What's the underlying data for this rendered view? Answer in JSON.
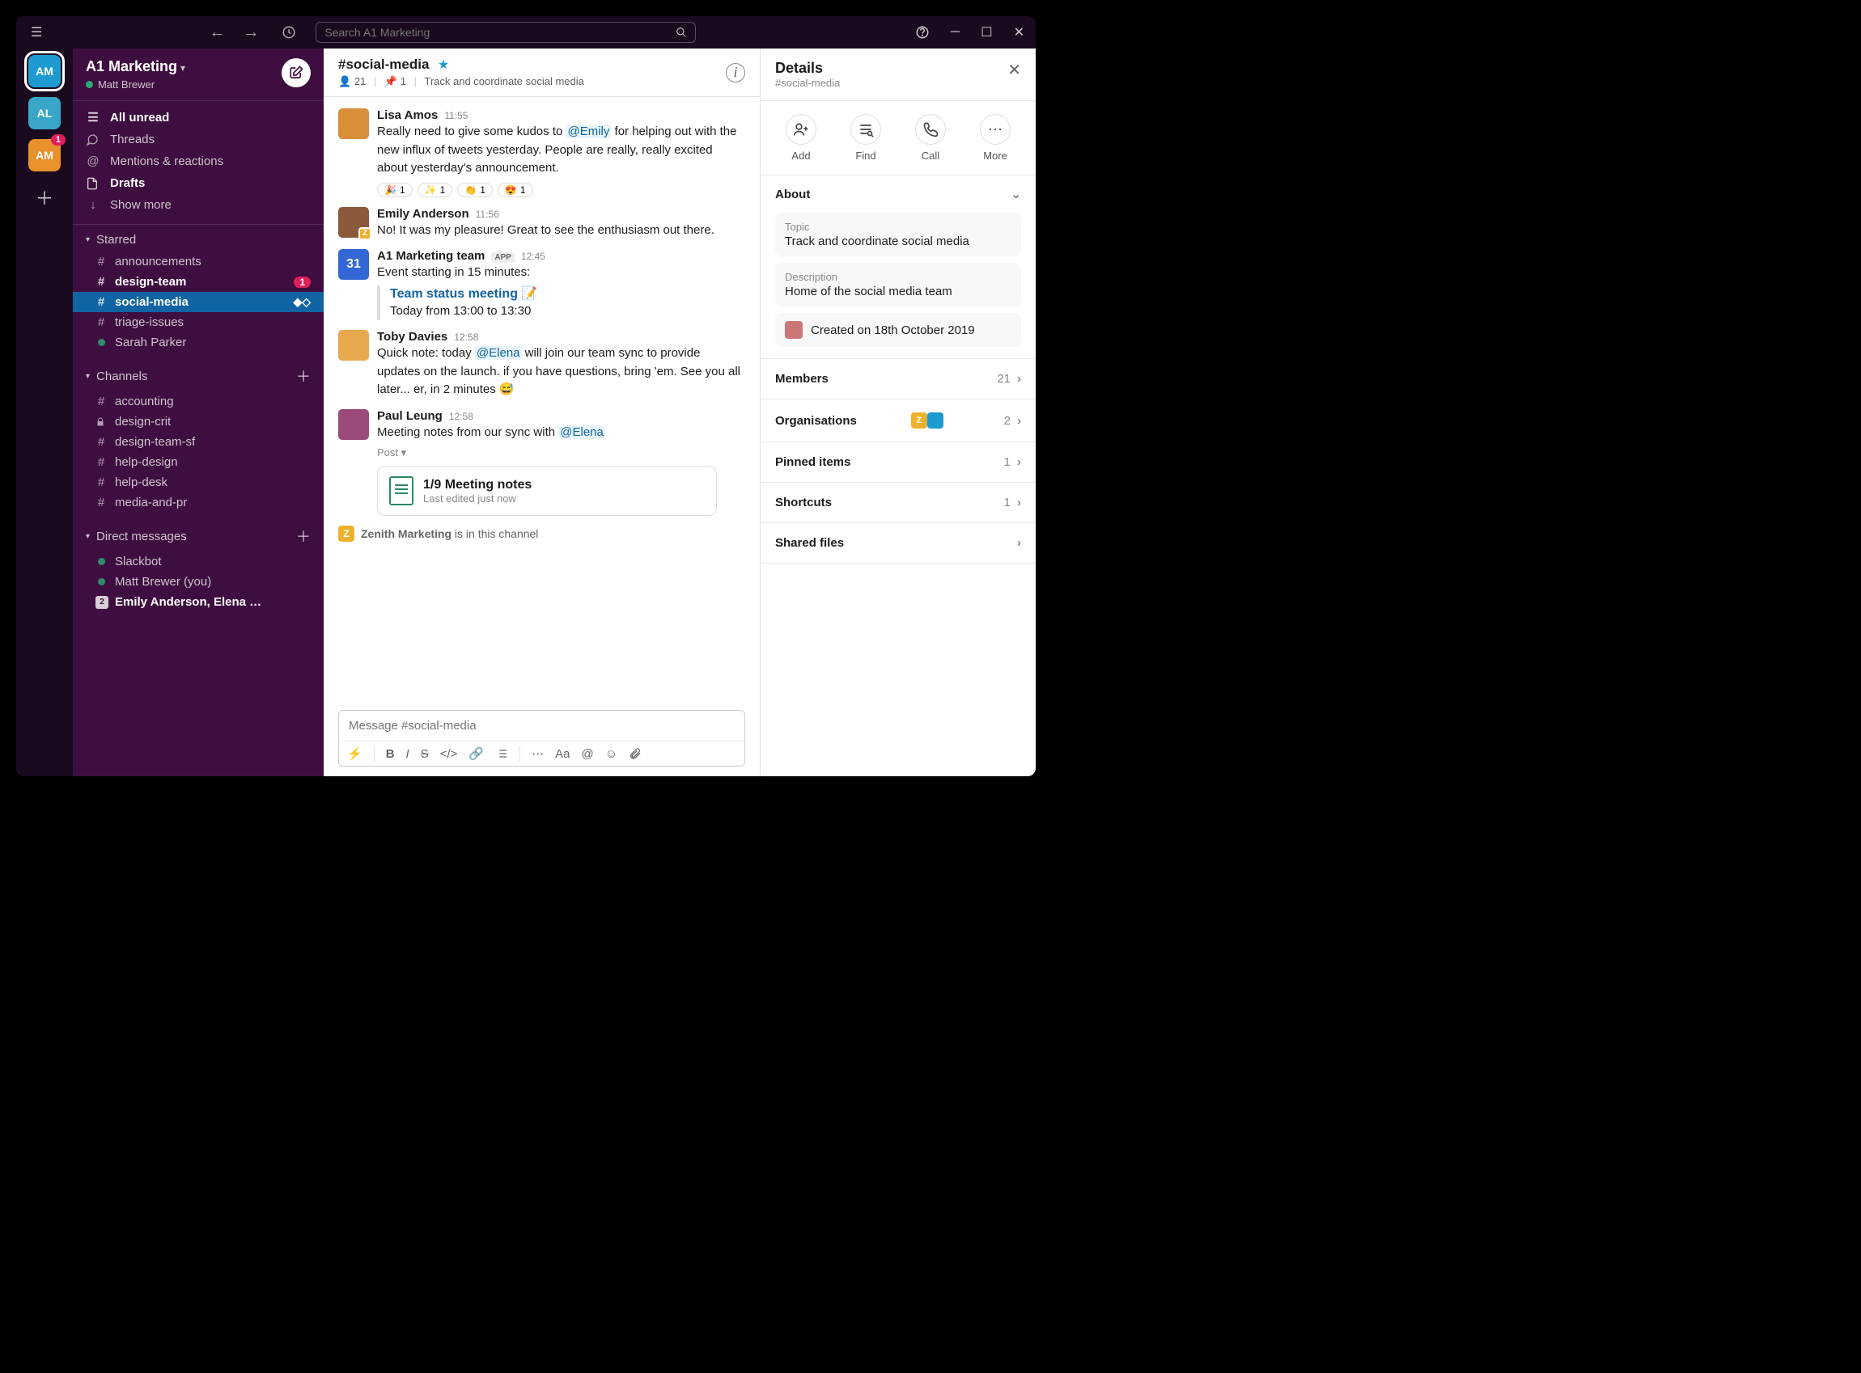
{
  "titlebar": {
    "search_placeholder": "Search A1 Marketing"
  },
  "rail": {
    "workspaces": [
      {
        "initials": "AM",
        "color": "#1d9bd1",
        "active": true,
        "badge": null
      },
      {
        "initials": "AL",
        "color": "#38a5c9",
        "active": false,
        "badge": null
      },
      {
        "initials": "AM",
        "color": "#e8912d",
        "active": false,
        "badge": "1"
      }
    ]
  },
  "sidebar": {
    "workspace_name": "A1 Marketing",
    "user_name": "Matt Brewer",
    "nav": {
      "all_unread": "All unread",
      "threads": "Threads",
      "mentions": "Mentions & reactions",
      "drafts": "Drafts",
      "show_more": "Show more"
    },
    "starred_label": "Starred",
    "starred": [
      {
        "name": "announcements",
        "prefix": "#",
        "bold": false
      },
      {
        "name": "design-team",
        "prefix": "#",
        "bold": true,
        "badge": "1"
      },
      {
        "name": "social-media",
        "prefix": "#",
        "bold": true,
        "active": true
      },
      {
        "name": "triage-issues",
        "prefix": "#",
        "bold": false
      },
      {
        "name": "Sarah Parker",
        "prefix": "dot",
        "bold": false
      }
    ],
    "channels_label": "Channels",
    "channels": [
      {
        "name": "accounting",
        "prefix": "#"
      },
      {
        "name": "design-crit",
        "prefix": "lock"
      },
      {
        "name": "design-team-sf",
        "prefix": "#"
      },
      {
        "name": "help-design",
        "prefix": "#"
      },
      {
        "name": "help-desk",
        "prefix": "#"
      },
      {
        "name": "media-and-pr",
        "prefix": "#"
      }
    ],
    "dms_label": "Direct messages",
    "dms": [
      {
        "name": "Slackbot",
        "prefix": "dot"
      },
      {
        "name": "Matt Brewer (you)",
        "prefix": "dot"
      },
      {
        "name": "Emily Anderson, Elena …",
        "prefix": "count",
        "count": "2",
        "bold": true
      }
    ]
  },
  "channelHeader": {
    "name": "#social-media",
    "members": "21",
    "pins": "1",
    "topic": "Track and coordinate social media"
  },
  "messages": [
    {
      "author": "Lisa Amos",
      "time": "11:55",
      "avatar_color": "#d98e3a",
      "pre": "Really need to give some kudos to ",
      "mention": "@Emily",
      "post": " for helping out with the new influx of tweets yesterday. People are really, really excited about yesterday's announcement.",
      "reactions": [
        {
          "emoji": "🎉",
          "count": "1"
        },
        {
          "emoji": "✨",
          "count": "1"
        },
        {
          "emoji": "👏",
          "count": "1"
        },
        {
          "emoji": "😍",
          "count": "1"
        }
      ]
    },
    {
      "author": "Emily Anderson",
      "time": "11:56",
      "avatar_color": "#8b5a3c",
      "corner_badge": "Z",
      "text": "No! It was my pleasure! Great to see the enthusiasm out there."
    },
    {
      "author": "A1 Marketing team",
      "time": "12:45",
      "app": "APP",
      "avatar_color": "#3367d6",
      "avatar_text": "31",
      "text": "Event starting in 15 minutes:",
      "event": {
        "title": "Team status meeting 📝",
        "when": "Today from 13:00 to 13:30"
      }
    },
    {
      "author": "Toby Davies",
      "time": "12:58",
      "avatar_color": "#e8a84d",
      "pre": "Quick note: today ",
      "mention": "@Elena",
      "post": " will join our team sync to provide updates on the launch. if you have questions, bring 'em. See you all later... er, in 2 minutes 😅"
    },
    {
      "author": "Paul Leung",
      "time": "12:58",
      "avatar_color": "#9b4a7a",
      "pre": "Meeting notes from our sync with ",
      "mention": "@Elena",
      "post_label": "Post ▾",
      "doc": {
        "title": "1/9 Meeting notes",
        "sub": "Last edited just now"
      }
    }
  ],
  "channel_note": {
    "badge": "Z",
    "org": "Zenith Marketing",
    "suffix": " is in this channel"
  },
  "composer": {
    "placeholder": "Message #social-media"
  },
  "details": {
    "title": "Details",
    "subtitle": "#social-media",
    "actions": {
      "add": "Add",
      "find": "Find",
      "call": "Call",
      "more": "More"
    },
    "about_label": "About",
    "topic_label": "Topic",
    "topic": "Track and coordinate social media",
    "desc_label": "Description",
    "description": "Home of the social media team",
    "created": "Created on 18th October 2019",
    "rows": {
      "members": {
        "label": "Members",
        "count": "21"
      },
      "orgs": {
        "label": "Organisations",
        "count": "2"
      },
      "pinned": {
        "label": "Pinned items",
        "count": "1"
      },
      "shortcuts": {
        "label": "Shortcuts",
        "count": "1"
      },
      "shared": {
        "label": "Shared files"
      }
    }
  }
}
